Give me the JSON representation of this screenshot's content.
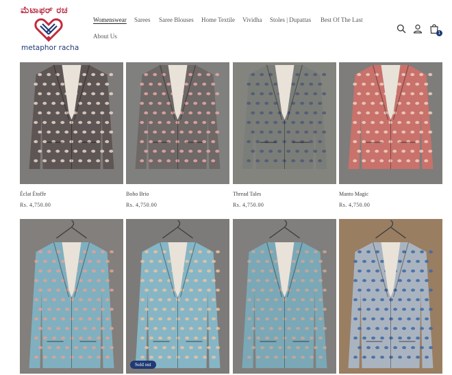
{
  "brand": {
    "script_text": "ಮೆಟಾಫರ್ ರಚ",
    "name": "metaphor racha"
  },
  "nav": {
    "items": [
      "Womenswear",
      "Sarees",
      "Saree Blouses",
      "Home Textile",
      "Vividha",
      "Stoles | Dupattas",
      "Best Of The Last",
      "About Us"
    ],
    "active": "Womenswear"
  },
  "header_icons": {
    "search": "search-icon",
    "account": "account-icon",
    "cart": "cart-icon",
    "cart_count": "1"
  },
  "products": [
    {
      "title": "Éclat Étoffe",
      "price": "Rs. 4,750.00",
      "colors": {
        "wall": "#7d7b79",
        "fabric": "#5d5654",
        "pattern": "#e9d6cb"
      }
    },
    {
      "title": "Boho Brio",
      "price": "Rs. 4,750.00",
      "colors": {
        "wall": "#80807e",
        "fabric": "#6e6866",
        "pattern": "#e7a9a7"
      }
    },
    {
      "title": "Thread Tales",
      "price": "Rs. 4,750.00",
      "colors": {
        "wall": "#84847f",
        "fabric": "#7b7d78",
        "pattern": "#4e5a76"
      }
    },
    {
      "title": "Manto Magic",
      "price": "Rs. 4,750.00",
      "colors": {
        "wall": "#7e7d7b",
        "fabric": "#c9716b",
        "pattern": "#f0d1c1"
      }
    },
    {
      "colors": {
        "wall": "#827f7c",
        "fabric": "#80b0bf",
        "pattern": "#e3a196"
      }
    },
    {
      "badge": "Sold out",
      "colors": {
        "wall": "#7c7b79",
        "fabric": "#86b6c5",
        "pattern": "#eac3a4"
      }
    },
    {
      "colors": {
        "wall": "#807f7d",
        "fabric": "#7aa8b6",
        "pattern": "#c9a79a"
      }
    },
    {
      "colors": {
        "wall": "#9a7e62",
        "fabric": "#aab4c0",
        "pattern": "#3f6aa3"
      }
    }
  ]
}
